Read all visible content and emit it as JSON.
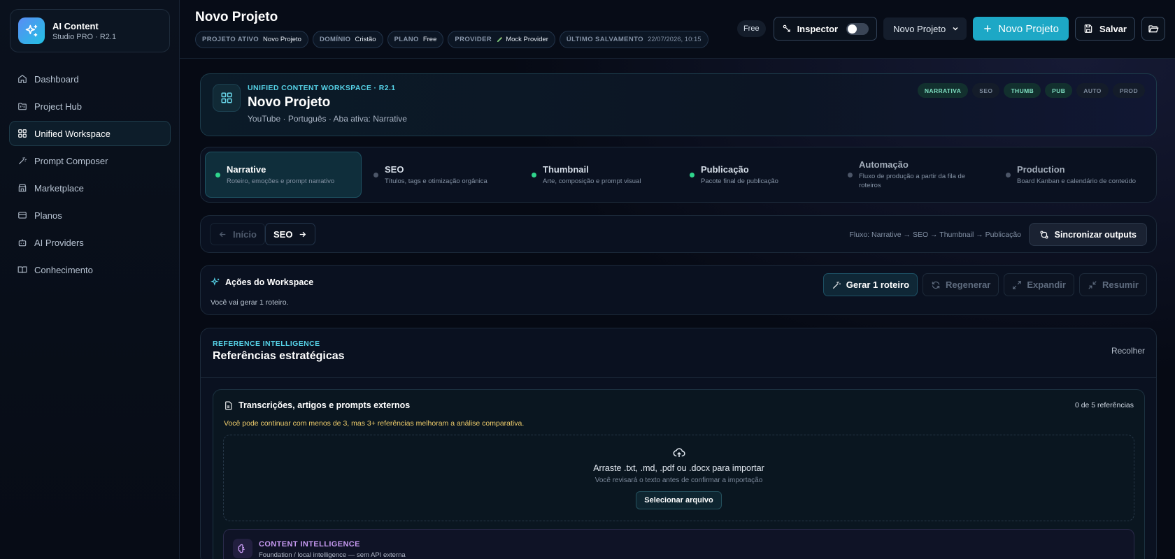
{
  "brand": {
    "name": "AI Content",
    "subtitle": "Studio PRO · R2.1"
  },
  "sidebar": {
    "items": [
      {
        "label": "Dashboard",
        "icon": "home-icon",
        "active": false
      },
      {
        "label": "Project Hub",
        "icon": "folder-kanban-icon",
        "active": false
      },
      {
        "label": "Unified Workspace",
        "icon": "grid-icon",
        "active": true
      },
      {
        "label": "Prompt Composer",
        "icon": "wand-icon",
        "active": false
      },
      {
        "label": "Marketplace",
        "icon": "store-icon",
        "active": false
      },
      {
        "label": "Planos",
        "icon": "credit-card-icon",
        "active": false
      },
      {
        "label": "AI Providers",
        "icon": "bot-icon",
        "active": false
      },
      {
        "label": "Conhecimento",
        "icon": "book-icon",
        "active": false
      }
    ]
  },
  "header": {
    "title": "Novo Projeto",
    "chips": [
      {
        "key": "PROJETO ATIVO",
        "value": "Novo Projeto"
      },
      {
        "key": "DOMÍNIO",
        "value": "Cristão"
      },
      {
        "key": "PLANO",
        "value": "Free"
      },
      {
        "key": "PROVIDER",
        "value": "Mock Provider"
      },
      {
        "key": "ÚLTIMO SALVAMENTO",
        "value": "22/07/2026, 10:15"
      }
    ],
    "plan_badge": "Free",
    "inspector_label": "Inspector",
    "inspector_on": false,
    "project_select": "Novo Projeto",
    "new_project_label": "Novo Projeto",
    "save_label": "Salvar"
  },
  "hero": {
    "eyebrow": "UNIFIED CONTENT WORKSPACE · R2.1",
    "title": "Novo Projeto",
    "meta": "YouTube · Português · Aba ativa: Narrative",
    "tags": [
      {
        "label": "NARRATIVA",
        "on": true
      },
      {
        "label": "SEO",
        "on": false
      },
      {
        "label": "THUMB",
        "on": true
      },
      {
        "label": "PUB",
        "on": true
      },
      {
        "label": "AUTO",
        "on": false
      },
      {
        "label": "PROD",
        "on": false
      }
    ]
  },
  "tabs": [
    {
      "label": "Narrative",
      "desc": "Roteiro, emoções e prompt narrativo",
      "status": "done",
      "active": true
    },
    {
      "label": "SEO",
      "desc": "Títulos, tags e otimização orgânica",
      "status": "pending",
      "active": false
    },
    {
      "label": "Thumbnail",
      "desc": "Arte, composição e prompt visual",
      "status": "done",
      "active": false
    },
    {
      "label": "Publicação",
      "desc": "Pacote final de publicação",
      "status": "done",
      "active": false
    },
    {
      "label": "Automação",
      "desc": "Fluxo de produção a partir da fila de roteiros",
      "status": "pending",
      "active": false
    },
    {
      "label": "Production",
      "desc": "Board Kanban e calendário de conteúdo",
      "status": "pending",
      "active": false
    }
  ],
  "flow": {
    "prev_label": "Início",
    "next_label": "SEO",
    "text": "Fluxo: Narrative → SEO → Thumbnail → Publicação",
    "sync_label": "Sincronizar outputs"
  },
  "actions": {
    "title": "Ações do Workspace",
    "desc": "Você vai gerar 1 roteiro.",
    "generate_label": "Gerar 1 roteiro",
    "regen_label": "Regenerar",
    "expand_label": "Expandir",
    "summarize_label": "Resumir"
  },
  "refs": {
    "eyebrow": "REFERENCE INTELLIGENCE",
    "title": "Referências estratégicas",
    "collapse_label": "Recolher",
    "inner_title": "Transcrições, artigos e prompts externos",
    "count": "0 de 5 referências",
    "warning": "Você pode continuar com menos de 3, mas 3+ referências melhoram a análise comparativa.",
    "drop_main": "Arraste .txt, .md, .pdf ou .docx para importar",
    "drop_sub": "Você revisará o texto antes de confirmar a importação",
    "select_file_label": "Selecionar arquivo"
  },
  "content_intel": {
    "title": "CONTENT INTELLIGENCE",
    "subtitle": "Foundation / local intelligence — sem API externa"
  },
  "colors": {
    "accent": "#1da8c6",
    "cyan_text": "#56d3e8",
    "green_dot": "#2fd58c",
    "warning": "#f2cf6c",
    "purple": "#c79af2"
  }
}
